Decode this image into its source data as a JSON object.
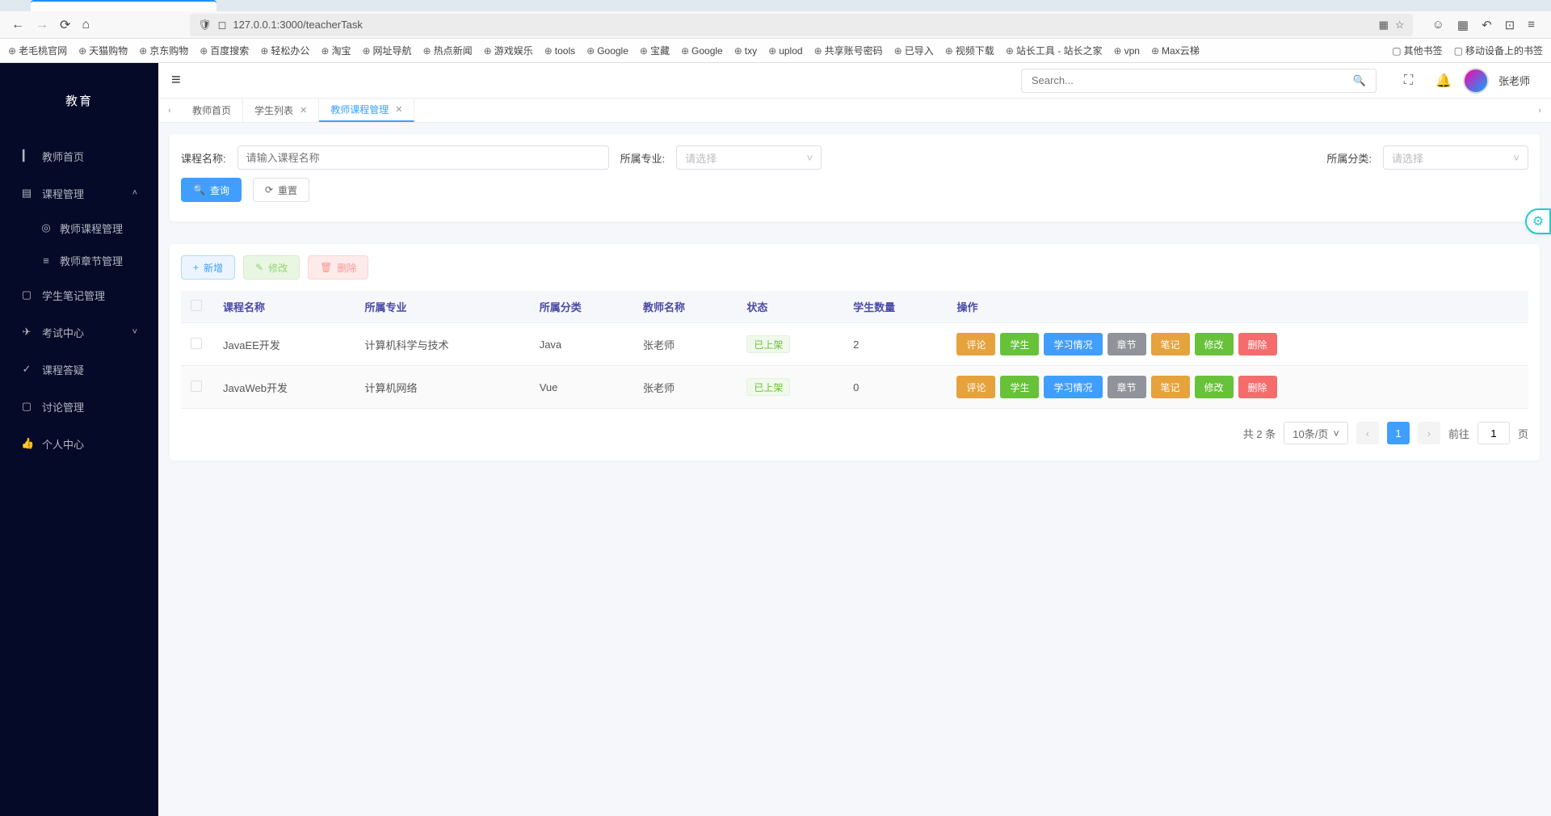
{
  "browser": {
    "url": "127.0.0.1:3000/teacherTask",
    "bookmarks_left": [
      "老毛桃官网",
      "天猫购物",
      "京东购物",
      "百度搜索",
      "轻松办公",
      "淘宝",
      "网址导航",
      "热点新闻",
      "游戏娱乐",
      "tools",
      "Google",
      "宝藏",
      "Google",
      "txy",
      "uplod",
      "共享账号密码",
      "已导入",
      "视频下载",
      "站长工具 - 站长之家",
      "vpn",
      "Max云梯"
    ],
    "bookmarks_right": [
      "其他书签",
      "移动设备上的书签"
    ]
  },
  "sidebar": {
    "brand": "教育",
    "items": [
      {
        "icon": "▎",
        "label": "教师首页"
      },
      {
        "icon": "▤",
        "label": "课程管理",
        "arrow": "˄"
      },
      {
        "icon": "◎",
        "label": "教师课程管理",
        "sub": true,
        "active": true
      },
      {
        "icon": "≡",
        "label": "教师章节管理",
        "sub": true
      },
      {
        "icon": "▢",
        "label": "学生笔记管理"
      },
      {
        "icon": "✈",
        "label": "考试中心",
        "arrow": "˅"
      },
      {
        "icon": "✓",
        "label": "课程答疑"
      },
      {
        "icon": "▢",
        "label": "讨论管理"
      },
      {
        "icon": "👍",
        "label": "个人中心"
      }
    ]
  },
  "topbar": {
    "search_placeholder": "Search...",
    "username": "张老师"
  },
  "tabs": [
    {
      "label": "教师首页",
      "closable": false
    },
    {
      "label": "学生列表",
      "closable": true
    },
    {
      "label": "教师课程管理",
      "closable": true,
      "active": true
    }
  ],
  "filter": {
    "label_name": "课程名称:",
    "placeholder_name": "请输入课程名称",
    "label_major": "所属专业:",
    "placeholder_major": "请选择",
    "label_category": "所属分类:",
    "placeholder_category": "请选择",
    "btn_query": "查询",
    "btn_reset": "重置"
  },
  "toolbar": {
    "btn_add": "新增",
    "btn_edit": "修改",
    "btn_delete": "删除"
  },
  "table": {
    "headers": [
      "课程名称",
      "所属专业",
      "所属分类",
      "教师名称",
      "状态",
      "学生数量",
      "操作"
    ],
    "rows": [
      {
        "name": "JavaEE开发",
        "major": "计算机科学与技术",
        "category": "Java",
        "teacher": "张老师",
        "status": "已上架",
        "count": "2"
      },
      {
        "name": "JavaWeb开发",
        "major": "计算机网络",
        "category": "Vue",
        "teacher": "张老师",
        "status": "已上架",
        "count": "0"
      }
    ],
    "actions": [
      "评论",
      "学生",
      "学习情况",
      "章节",
      "笔记",
      "修改",
      "删除"
    ]
  },
  "pager": {
    "total_prefix": "共",
    "total": "2",
    "total_suffix": "条",
    "size": "10条/页",
    "page": "1",
    "goto_prefix": "前往",
    "goto_val": "1",
    "goto_suffix": "页"
  }
}
